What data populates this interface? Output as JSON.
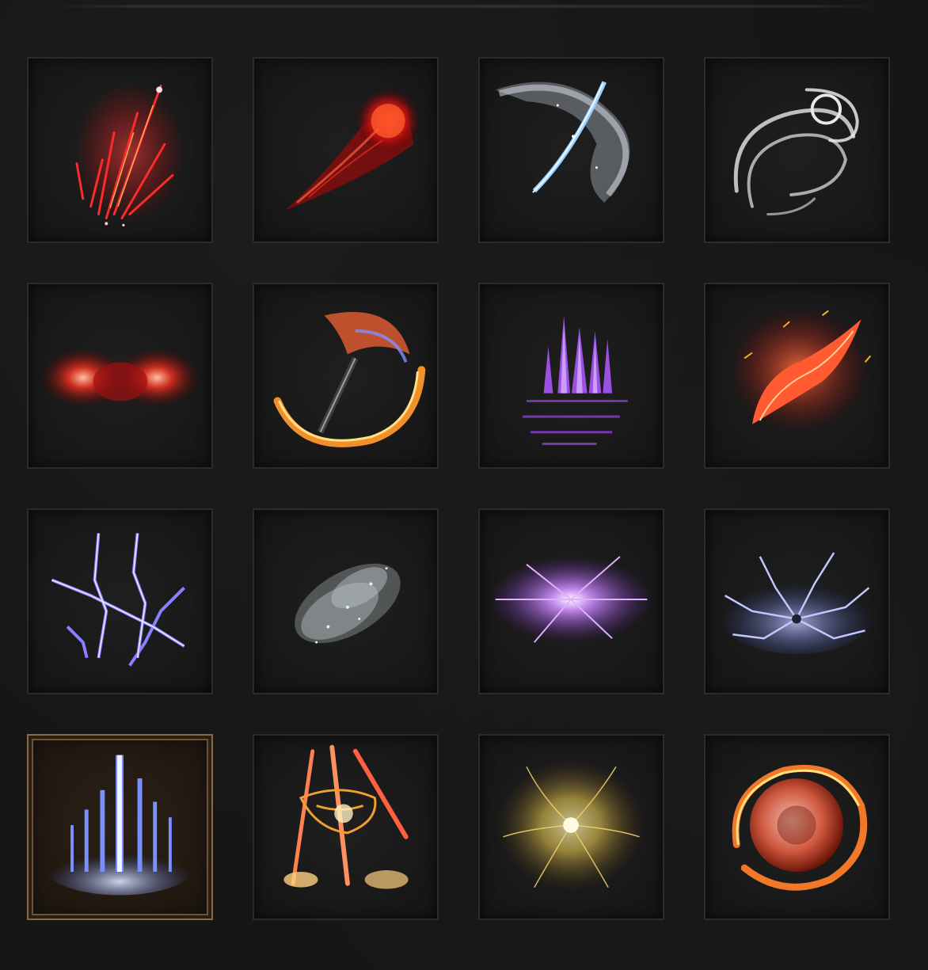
{
  "grid": {
    "columns": 4,
    "rows": 4,
    "selected_index": 12,
    "items": [
      {
        "icon": "red-crystal-shards-icon",
        "color": "#e0202a"
      },
      {
        "icon": "crimson-fire-comet-icon",
        "color": "#e33218"
      },
      {
        "icon": "frost-blade-swirl-icon",
        "color": "#b8c8d8"
      },
      {
        "icon": "white-spirit-vortex-icon",
        "color": "#d8d8d8"
      },
      {
        "icon": "crimson-blood-burst-icon",
        "color": "#d8302a"
      },
      {
        "icon": "flaming-sickle-arc-icon",
        "color": "#f0902a"
      },
      {
        "icon": "violet-crystal-pillars-icon",
        "color": "#9a50e0"
      },
      {
        "icon": "fiery-phoenix-wing-icon",
        "color": "#f04a20"
      },
      {
        "icon": "blue-lightning-claw-icon",
        "color": "#8a80ff"
      },
      {
        "icon": "grey-mist-cloud-icon",
        "color": "#b8c0c4"
      },
      {
        "icon": "violet-starburst-icon",
        "color": "#b060f0"
      },
      {
        "icon": "blue-lightning-storm-icon",
        "color": "#8898ff"
      },
      {
        "icon": "ice-spire-eruption-icon",
        "color": "#9ab8ff"
      },
      {
        "icon": "golden-meteor-strike-icon",
        "color": "#f0a030"
      },
      {
        "icon": "golden-radiance-burst-icon",
        "color": "#e8d070"
      },
      {
        "icon": "fire-orb-ring-icon",
        "color": "#f07828"
      }
    ]
  }
}
